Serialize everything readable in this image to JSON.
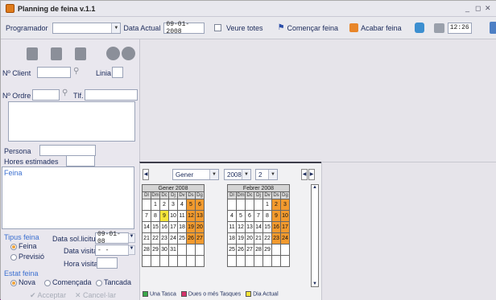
{
  "window": {
    "title": "Planning de feina v.1.1"
  },
  "toolbar": {
    "programador_label": "Programador",
    "programador_value": "",
    "data_actual_label": "Data Actual",
    "data_actual_value": "09-01-2008",
    "veure_totes_label": "Veure totes",
    "comencar_label": "Començar feina",
    "acabar_label": "Acabar feina",
    "time_value": "12:26"
  },
  "form": {
    "client_label": "Nº Client",
    "linia_label": "Linia",
    "ordre_label": "Nº Ordre",
    "tlf_label": "Tlf.",
    "persona_label": "Persona",
    "hores_label": "Hores estimades",
    "feina_label": "Feina",
    "tipus_label": "Tipus feina",
    "tipus_options": [
      "Feina",
      "Previsió"
    ],
    "data_sol_label": "Data sol.licitud",
    "data_sol_value": "09-01-08",
    "data_visita_label": "Data visita",
    "data_visita_value": "-  -",
    "hora_visita_label": "Hora visita",
    "estat_label": "Estat feina",
    "estat_options": [
      "Nova",
      "Començada",
      "Tancada"
    ],
    "acceptar_label": "Acceptar",
    "cancelar_label": "Cancel·lar"
  },
  "calendar": {
    "month_select": "Gener",
    "year_select": "2008",
    "count_select": "2",
    "day_headers": [
      "Dl",
      "Dm",
      "Dc",
      "Dj",
      "Dv",
      "Ds",
      "Dg"
    ],
    "months": [
      {
        "name": "Gener 2008",
        "weeks": [
          [
            "",
            "1",
            "2",
            "3",
            "4",
            "5",
            "6"
          ],
          [
            "7",
            "8",
            "9",
            "10",
            "11",
            "12",
            "13"
          ],
          [
            "14",
            "15",
            "16",
            "17",
            "18",
            "19",
            "20"
          ],
          [
            "21",
            "22",
            "23",
            "24",
            "25",
            "26",
            "27"
          ],
          [
            "28",
            "29",
            "30",
            "31",
            "",
            "",
            ""
          ],
          [
            "",
            "",
            "",
            "",
            "",
            "",
            ""
          ]
        ],
        "today": "9"
      },
      {
        "name": "Febrer 2008",
        "weeks": [
          [
            "",
            "",
            "",
            "",
            "1",
            "2",
            "3"
          ],
          [
            "4",
            "5",
            "6",
            "7",
            "8",
            "9",
            "10"
          ],
          [
            "11",
            "12",
            "13",
            "14",
            "15",
            "16",
            "17"
          ],
          [
            "18",
            "19",
            "20",
            "21",
            "22",
            "23",
            "24"
          ],
          [
            "25",
            "26",
            "27",
            "28",
            "29",
            "",
            ""
          ],
          [
            "",
            "",
            "",
            "",
            "",
            "",
            ""
          ]
        ],
        "today": ""
      }
    ],
    "legend": [
      "Una Tasca",
      "Dues o més Tasques",
      "Dia Actual"
    ],
    "colors": {
      "weekend": "#f29a2e",
      "today": "#f4e43a",
      "one_task": "#3aa84a",
      "multi_task": "#d6336c"
    }
  }
}
